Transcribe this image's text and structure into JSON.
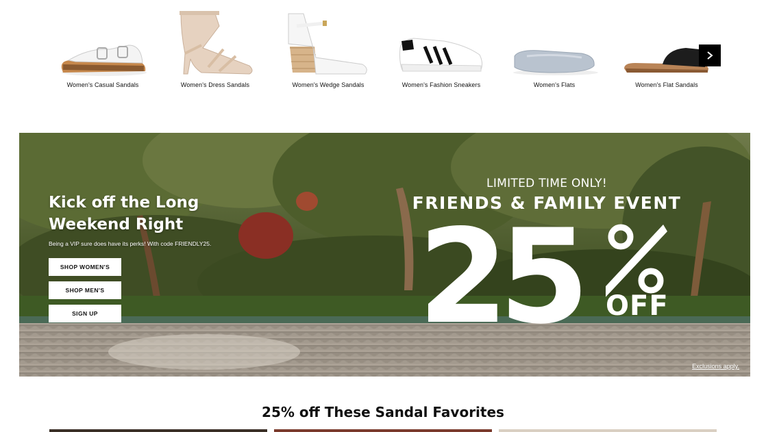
{
  "categories": [
    {
      "label": "Women's Casual Sandals",
      "icon": "casual-sandal-image"
    },
    {
      "label": "Women's Dress Sandals",
      "icon": "dress-sandal-image"
    },
    {
      "label": "Women's Wedge Sandals",
      "icon": "wedge-sandal-image"
    },
    {
      "label": "Women's Fashion Sneakers",
      "icon": "sneaker-image"
    },
    {
      "label": "Women's Flats",
      "icon": "flat-image"
    },
    {
      "label": "Women's Flat Sandals",
      "icon": "flat-sandal-image"
    }
  ],
  "carousel": {
    "next_icon": "chevron-right-icon"
  },
  "hero": {
    "headline": "Kick off the Long Weekend Right",
    "subtext": "Being a VIP sure does have its perks! With code FRIENDLY25.",
    "buttons": [
      "SHOP WOMEN'S",
      "SHOP MEN'S",
      "SIGN UP"
    ],
    "promo_limited": "LIMITED TIME ONLY!",
    "promo_event": "FRIENDS & FAMILY EVENT",
    "promo_number": "25",
    "promo_off": "OFF",
    "exclusions": "Exclusions apply."
  },
  "section": {
    "title": "25% off These Sandal Favorites"
  },
  "colors": {
    "button_dark": "#000000",
    "text": "#111111",
    "foliage": "#3e4a22",
    "path": "#9a8f84"
  }
}
